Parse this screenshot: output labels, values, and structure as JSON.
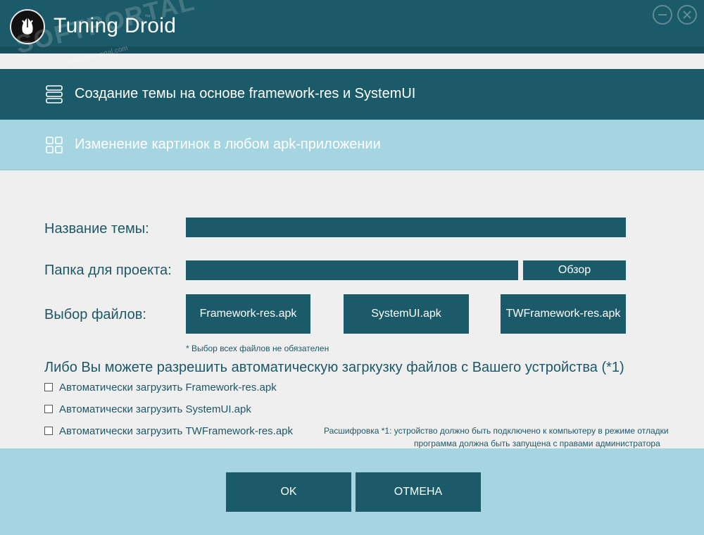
{
  "app": {
    "title": "Tuning Droid",
    "watermark": "SOFTPORTAL",
    "watermark_sub": "www.softportal.com",
    "watermark_tm": "™"
  },
  "nav": {
    "items": [
      {
        "label": "Создание темы на основе framework-res и SystemUI",
        "icon": "list-icon",
        "active": true
      },
      {
        "label": "Изменение картинок в любом apk-приложении",
        "icon": "grid-icon",
        "active": false
      }
    ]
  },
  "form": {
    "theme_name_label": "Название темы:",
    "theme_name_value": "",
    "project_folder_label": "Папка для проекта:",
    "project_folder_value": "",
    "browse_label": "Обзор",
    "files_label": "Выбор файлов:",
    "file_buttons": [
      "Framework-res.apk",
      "SystemUI.apk",
      "TWFramework-res.apk"
    ],
    "files_note": "* Выбор всех файлов не обязателен"
  },
  "auto": {
    "heading": "Либо Вы можете разрешить автоматическую загркузку файлов с Вашего устройства (*1)",
    "options": [
      {
        "label": "Автоматически загрузить Framework-res.apk",
        "checked": false
      },
      {
        "label": "Автоматически загрузить SystemUI.apk",
        "checked": false
      },
      {
        "label": "Автоматически загрузить TWFramework-res.apk",
        "checked": false
      }
    ],
    "footnote_line1": "Расшифровка *1: устройство должно быть подключено к компьютеру в режиме отладки",
    "footnote_line2": "программа должна быть запущена с правами администратора"
  },
  "footer": {
    "ok_label": "OK",
    "cancel_label": "ОТМЕНА"
  },
  "colors": {
    "primary": "#1b5a68",
    "light": "#a5d5e0",
    "background": "#efefef",
    "text": "#1e5766"
  }
}
